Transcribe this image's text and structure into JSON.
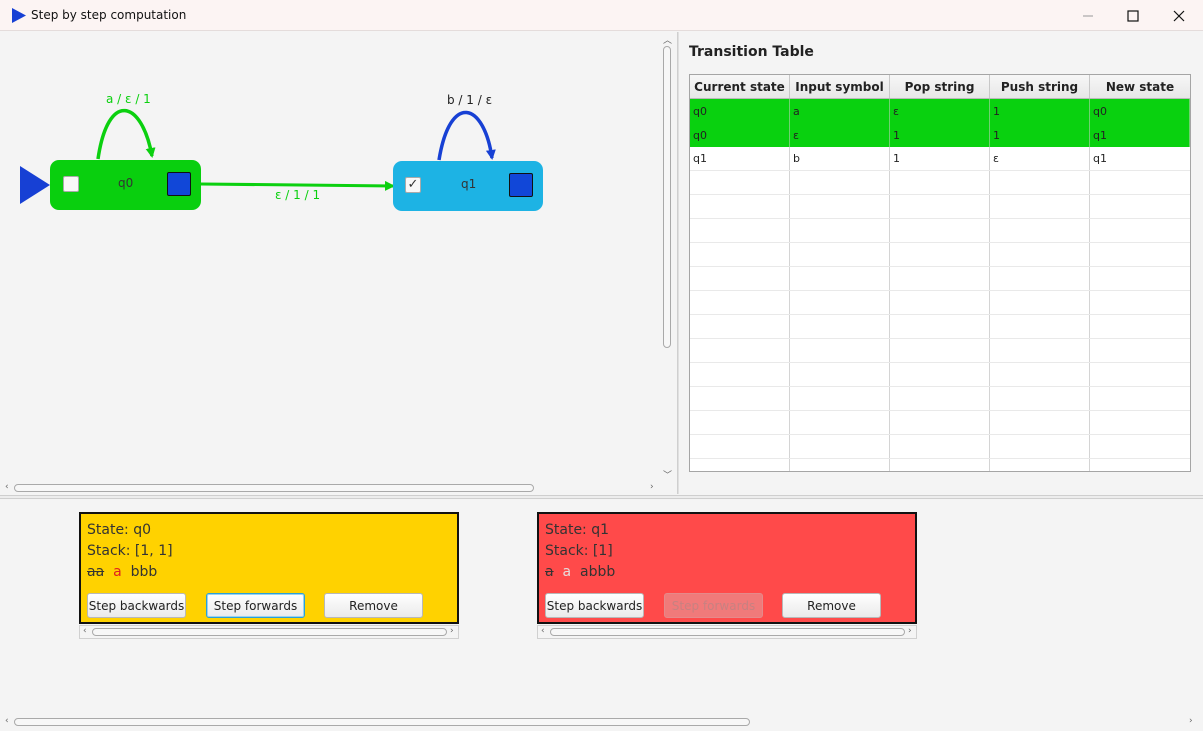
{
  "window": {
    "title": "Step by step computation",
    "controls": {
      "minimize": "minimize-icon",
      "maximize": "maximize-icon",
      "close": "close-icon"
    }
  },
  "graph": {
    "states": [
      {
        "name": "q0",
        "initial": true,
        "final": false,
        "active": true,
        "color": "#09cf0e"
      },
      {
        "name": "q1",
        "initial": false,
        "final": true,
        "active": false,
        "color": "#1db3e4"
      }
    ],
    "transitions": [
      {
        "from": "q0",
        "to": "q0",
        "label": "a / ε / 1",
        "color": "#0bd00f"
      },
      {
        "from": "q0",
        "to": "q1",
        "label": "ε / 1 / 1",
        "color": "#0bd00f"
      },
      {
        "from": "q1",
        "to": "q1",
        "label": "b / 1 / ε",
        "color": "#1740d4"
      }
    ]
  },
  "transition_table": {
    "title": "Transition Table",
    "columns": [
      "Current state",
      "Input symbol",
      "Pop string",
      "Push string",
      "New state"
    ],
    "rows": [
      {
        "cells": [
          "q0",
          "a",
          "ε",
          "1",
          "q0"
        ],
        "highlighted": true
      },
      {
        "cells": [
          "q0",
          "ε",
          "1",
          "1",
          "q1"
        ],
        "highlighted": true
      },
      {
        "cells": [
          "q1",
          "b",
          "1",
          "ε",
          "q1"
        ],
        "highlighted": false
      }
    ],
    "highlight_color": "#09d10f"
  },
  "configurations": [
    {
      "state_text": "State: q0",
      "stack_text": "Stack: [1, 1]",
      "input": {
        "consumed": "aa",
        "current": "a",
        "remaining": "bbb"
      },
      "color": "#ffd200",
      "buttons": {
        "back": "Step backwards",
        "forward": "Step forwards",
        "remove": "Remove"
      },
      "forward_enabled": true
    },
    {
      "state_text": "State: q1",
      "stack_text": "Stack: [1]",
      "input": {
        "consumed": "a",
        "current": "a",
        "remaining": "abbb"
      },
      "color": "#ff4a4a",
      "buttons": {
        "back": "Step backwards",
        "forward": "Step forwards",
        "remove": "Remove"
      },
      "forward_enabled": false
    }
  ]
}
